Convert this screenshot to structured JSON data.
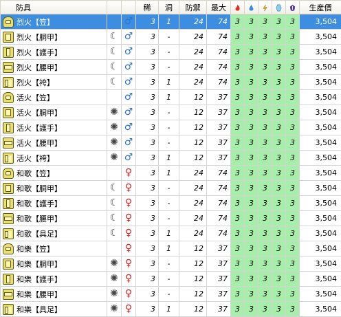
{
  "headers": {
    "name": "防具",
    "rarity": "稀",
    "slots": "洞",
    "defense": "防禦",
    "max": "最大",
    "price": "生産價"
  },
  "res_icons": [
    "fire-resistance-icon",
    "water-resistance-icon",
    "thunder-resistance-icon",
    "ice-resistance-icon",
    "dragon-resistance-icon"
  ],
  "rows": [
    {
      "name": "烈火【笠】",
      "part": "helm",
      "skill": "",
      "gender": "male",
      "rarity": "3",
      "slots": "1",
      "defense": "24",
      "max": "74",
      "res": [
        "3",
        "3",
        "3",
        "3",
        "3"
      ],
      "price": "3,504",
      "selected": true
    },
    {
      "name": "烈火【胴甲】",
      "part": "body",
      "skill": "claw",
      "gender": "male",
      "rarity": "3",
      "slots": "-",
      "defense": "24",
      "max": "74",
      "res": [
        "3",
        "3",
        "3",
        "3",
        "3"
      ],
      "price": "3,504"
    },
    {
      "name": "烈火【護手】",
      "part": "arm",
      "skill": "claw",
      "gender": "male",
      "rarity": "3",
      "slots": "-",
      "defense": "24",
      "max": "74",
      "res": [
        "3",
        "3",
        "3",
        "3",
        "3"
      ],
      "price": "3,504"
    },
    {
      "name": "烈火【腰甲】",
      "part": "waist",
      "skill": "claw",
      "gender": "male",
      "rarity": "3",
      "slots": "-",
      "defense": "24",
      "max": "74",
      "res": [
        "3",
        "3",
        "3",
        "3",
        "3"
      ],
      "price": "3,504"
    },
    {
      "name": "烈火【袴】",
      "part": "leg",
      "skill": "claw",
      "gender": "male",
      "rarity": "3",
      "slots": "1",
      "defense": "24",
      "max": "74",
      "res": [
        "3",
        "3",
        "3",
        "3",
        "3"
      ],
      "price": "3,504"
    },
    {
      "name": "活火【笠】",
      "part": "helm",
      "skill": "",
      "gender": "male",
      "rarity": "3",
      "slots": "1",
      "defense": "12",
      "max": "37",
      "res": [
        "3",
        "3",
        "3",
        "3",
        "3"
      ],
      "price": "3,504"
    },
    {
      "name": "活火【胴甲】",
      "part": "body",
      "skill": "gear",
      "gender": "male",
      "rarity": "3",
      "slots": "-",
      "defense": "12",
      "max": "37",
      "res": [
        "3",
        "3",
        "3",
        "3",
        "3"
      ],
      "price": "3,504"
    },
    {
      "name": "活火【護手】",
      "part": "arm",
      "skill": "gear",
      "gender": "male",
      "rarity": "3",
      "slots": "-",
      "defense": "12",
      "max": "37",
      "res": [
        "3",
        "3",
        "3",
        "3",
        "3"
      ],
      "price": "3,504"
    },
    {
      "name": "活火【腰甲】",
      "part": "waist",
      "skill": "gear",
      "gender": "male",
      "rarity": "3",
      "slots": "-",
      "defense": "12",
      "max": "37",
      "res": [
        "3",
        "3",
        "3",
        "3",
        "3"
      ],
      "price": "3,504"
    },
    {
      "name": "活火【袴】",
      "part": "leg",
      "skill": "gear",
      "gender": "male",
      "rarity": "3",
      "slots": "1",
      "defense": "12",
      "max": "37",
      "res": [
        "3",
        "3",
        "3",
        "3",
        "3"
      ],
      "price": "3,504"
    },
    {
      "name": "和歌【笠】",
      "part": "helm",
      "skill": "",
      "gender": "female",
      "rarity": "3",
      "slots": "1",
      "defense": "24",
      "max": "74",
      "res": [
        "3",
        "3",
        "3",
        "3",
        "3"
      ],
      "price": "3,504"
    },
    {
      "name": "和歌【胴甲】",
      "part": "body",
      "skill": "claw",
      "gender": "female",
      "rarity": "3",
      "slots": "-",
      "defense": "24",
      "max": "74",
      "res": [
        "3",
        "3",
        "3",
        "3",
        "3"
      ],
      "price": "3,504"
    },
    {
      "name": "和歌【護手】",
      "part": "arm",
      "skill": "claw",
      "gender": "female",
      "rarity": "3",
      "slots": "-",
      "defense": "24",
      "max": "74",
      "res": [
        "3",
        "3",
        "3",
        "3",
        "3"
      ],
      "price": "3,504"
    },
    {
      "name": "和歌【腰甲】",
      "part": "waist",
      "skill": "claw",
      "gender": "female",
      "rarity": "3",
      "slots": "-",
      "defense": "24",
      "max": "74",
      "res": [
        "3",
        "3",
        "3",
        "3",
        "3"
      ],
      "price": "3,504"
    },
    {
      "name": "和歌【具足】",
      "part": "leg",
      "skill": "claw",
      "gender": "female",
      "rarity": "3",
      "slots": "1",
      "defense": "24",
      "max": "74",
      "res": [
        "3",
        "3",
        "3",
        "3",
        "3"
      ],
      "price": "3,504"
    },
    {
      "name": "和樂【笠】",
      "part": "helm",
      "skill": "",
      "gender": "female",
      "rarity": "3",
      "slots": "1",
      "defense": "12",
      "max": "37",
      "res": [
        "3",
        "3",
        "3",
        "3",
        "3"
      ],
      "price": "3,504"
    },
    {
      "name": "和樂【胴甲】",
      "part": "body",
      "skill": "gear",
      "gender": "female",
      "rarity": "3",
      "slots": "-",
      "defense": "12",
      "max": "37",
      "res": [
        "3",
        "3",
        "3",
        "3",
        "3"
      ],
      "price": "3,504"
    },
    {
      "name": "和樂【護手】",
      "part": "arm",
      "skill": "gear",
      "gender": "female",
      "rarity": "3",
      "slots": "-",
      "defense": "12",
      "max": "37",
      "res": [
        "3",
        "3",
        "3",
        "3",
        "3"
      ],
      "price": "3,504"
    },
    {
      "name": "和樂【腰甲】",
      "part": "waist",
      "skill": "gear",
      "gender": "female",
      "rarity": "3",
      "slots": "-",
      "defense": "12",
      "max": "37",
      "res": [
        "3",
        "3",
        "3",
        "3",
        "3"
      ],
      "price": "3,504"
    },
    {
      "name": "和樂【具足】",
      "part": "leg",
      "skill": "gear",
      "gender": "female",
      "rarity": "3",
      "slots": "1",
      "defense": "12",
      "max": "37",
      "res": [
        "3",
        "3",
        "3",
        "3",
        "3"
      ],
      "price": "3,504"
    }
  ]
}
